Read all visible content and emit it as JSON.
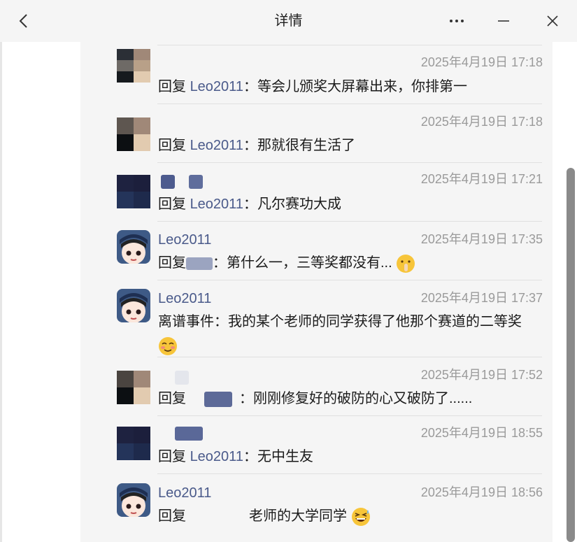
{
  "window": {
    "title": "详情",
    "back_icon": "chevron-left-icon",
    "more_icon": "more-horizontal-icon",
    "minimize_icon": "minimize-icon",
    "close_icon": "close-icon"
  },
  "comments": [
    {
      "name": "",
      "time": "2025年4月19日 17:18",
      "reply_prefix": "回复",
      "mention": "Leo2011",
      "text": "：等会儿颁奖大屏幕出来，你排第一",
      "avatar_colors": [
        "#2b2f36",
        "#a08878",
        "#6e6a66",
        "#b8a088",
        "#161a1e",
        "#e2cbb0"
      ]
    },
    {
      "name": "",
      "time": "2025年4月19日 17:18",
      "reply_prefix": "回复",
      "mention": "Leo2011",
      "text": "：那就很有生活了",
      "avatar_colors": [
        "#5e5650",
        "#a08878",
        "#0c0f12",
        "#e2cbb0"
      ]
    },
    {
      "name": "",
      "time": "2025年4月19日 17:21",
      "reply_prefix": "回复",
      "mention": "Leo2011",
      "text": "：凡尔赛功大成",
      "avatar_colors": [
        "#1e2240",
        "#1c1f3c",
        "#24345a",
        "#1e2a4c"
      ]
    },
    {
      "name": "Leo2011",
      "time": "2025年4月19日 17:35",
      "reply_prefix": "回复",
      "mention": "",
      "text": "：第什么一，三等奖都没有...",
      "emoji": "shush-emoji"
    },
    {
      "name": "Leo2011",
      "time": "2025年4月19日 17:37",
      "reply_prefix": "",
      "mention": "",
      "text": "离谱事件：我的某个老师的同学获得了他那个赛道的二等奖",
      "emoji": "blush-emoji"
    },
    {
      "name": "",
      "time": "2025年4月19日 17:52",
      "reply_prefix": "回复",
      "mention": "",
      "text": "：刚刚修复好的破防的心又破防了......",
      "avatar_colors": [
        "#4a4440",
        "#a08878",
        "#0c0f12",
        "#e2cbb0"
      ]
    },
    {
      "name": "",
      "time": "2025年4月19日 18:55",
      "reply_prefix": "回复",
      "mention": "Leo2011",
      "text": "：无中生友",
      "avatar_colors": [
        "#1e2240",
        "#1c1f3c",
        "#24345a",
        "#1e2a4c"
      ]
    },
    {
      "name": "Leo2011",
      "time": "2025年4月19日 18:56",
      "reply_prefix": "回复",
      "mention": "",
      "text": "老师的大学同学",
      "emoji": "grin-sweat-emoji"
    }
  ]
}
